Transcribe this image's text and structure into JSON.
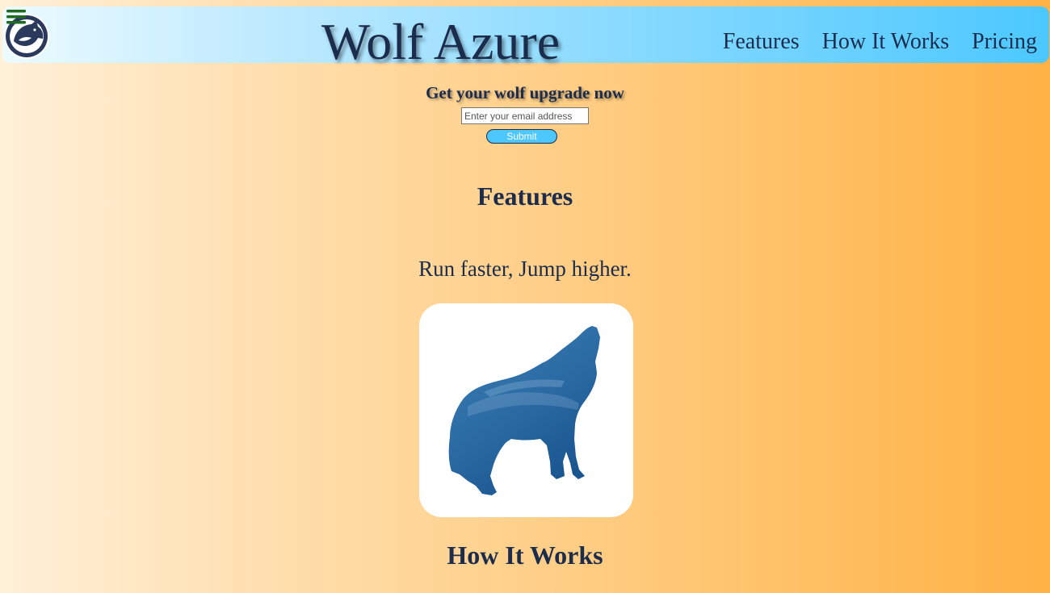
{
  "header": {
    "brand_title": "Wolf Azure",
    "nav": [
      {
        "label": "Features"
      },
      {
        "label": "How It Works"
      },
      {
        "label": "Pricing"
      }
    ]
  },
  "signup": {
    "heading": "Get your wolf upgrade now",
    "email_placeholder": "Enter your email address",
    "submit_label": "Submit"
  },
  "features": {
    "heading": "Features",
    "text": "Run faster, Jump higher."
  },
  "how_it_works": {
    "heading": "How It Works"
  },
  "icons": {
    "menu": "hamburger-menu-icon",
    "logo": "wolf-logo",
    "wolf_image": "howling-wolf-silhouette"
  },
  "colors": {
    "brand_navy": "#1c2c4c",
    "accent_blue": "#4cc8ff",
    "menu_green": "#1f6b22",
    "background_orange": "#ffb144"
  }
}
